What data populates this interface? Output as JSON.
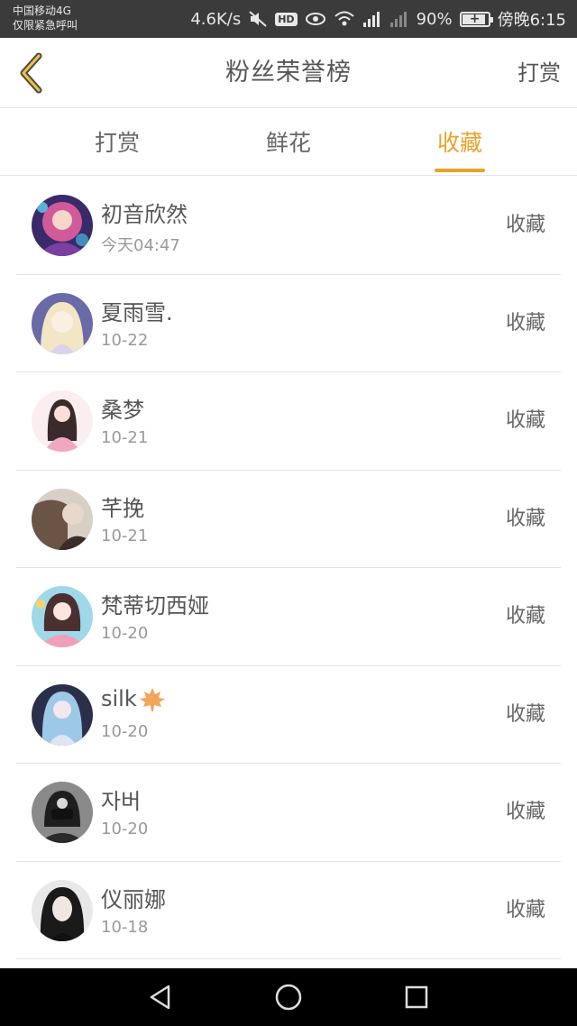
{
  "status_bar": {
    "carrier_line1": "中国移动4G",
    "carrier_line2": "仅限紧急呼叫",
    "net_speed": "4.6K/s",
    "hd": "HD",
    "battery": "90%",
    "time": "傍晚6:15",
    "icons": [
      "mute-icon",
      "eye-icon",
      "wifi-icon",
      "signal-icon",
      "battery-icon"
    ]
  },
  "header": {
    "title": "粉丝荣誉榜",
    "action": "打赏",
    "back_icon": "chevron-left-icon"
  },
  "tabs": [
    {
      "label": "打赏",
      "active": false
    },
    {
      "label": "鲜花",
      "active": false
    },
    {
      "label": "收藏",
      "active": true
    }
  ],
  "list": [
    {
      "name": "初音欣然",
      "date": "今天04:47",
      "action": "收藏",
      "avatar_color": "#c2488a"
    },
    {
      "name": "夏雨雪.",
      "date": "10-22",
      "action": "收藏",
      "avatar_color": "#b9b3d8"
    },
    {
      "name": "桑梦",
      "date": "10-21",
      "action": "收藏",
      "avatar_color": "#f0c6d2"
    },
    {
      "name": "芊挽",
      "date": "10-21",
      "action": "收藏",
      "avatar_color": "#8c7768"
    },
    {
      "name": "梵蒂切西娅",
      "date": "10-20",
      "action": "收藏",
      "avatar_color": "#e8a6b8"
    },
    {
      "name": "silk",
      "date": "10-20",
      "action": "收藏",
      "avatar_color": "#4d5f8c",
      "emoji": "maple-leaf-icon"
    },
    {
      "name": "자버",
      "date": "10-20",
      "action": "收藏",
      "avatar_color": "#5a5a5a"
    },
    {
      "name": "仪丽娜",
      "date": "10-18",
      "action": "收藏",
      "avatar_color": "#2e2e2e"
    }
  ],
  "colors": {
    "accent": "#e8a32a",
    "status_bar_bg": "#3b3b3b",
    "nav_bar_bg": "#000000"
  }
}
